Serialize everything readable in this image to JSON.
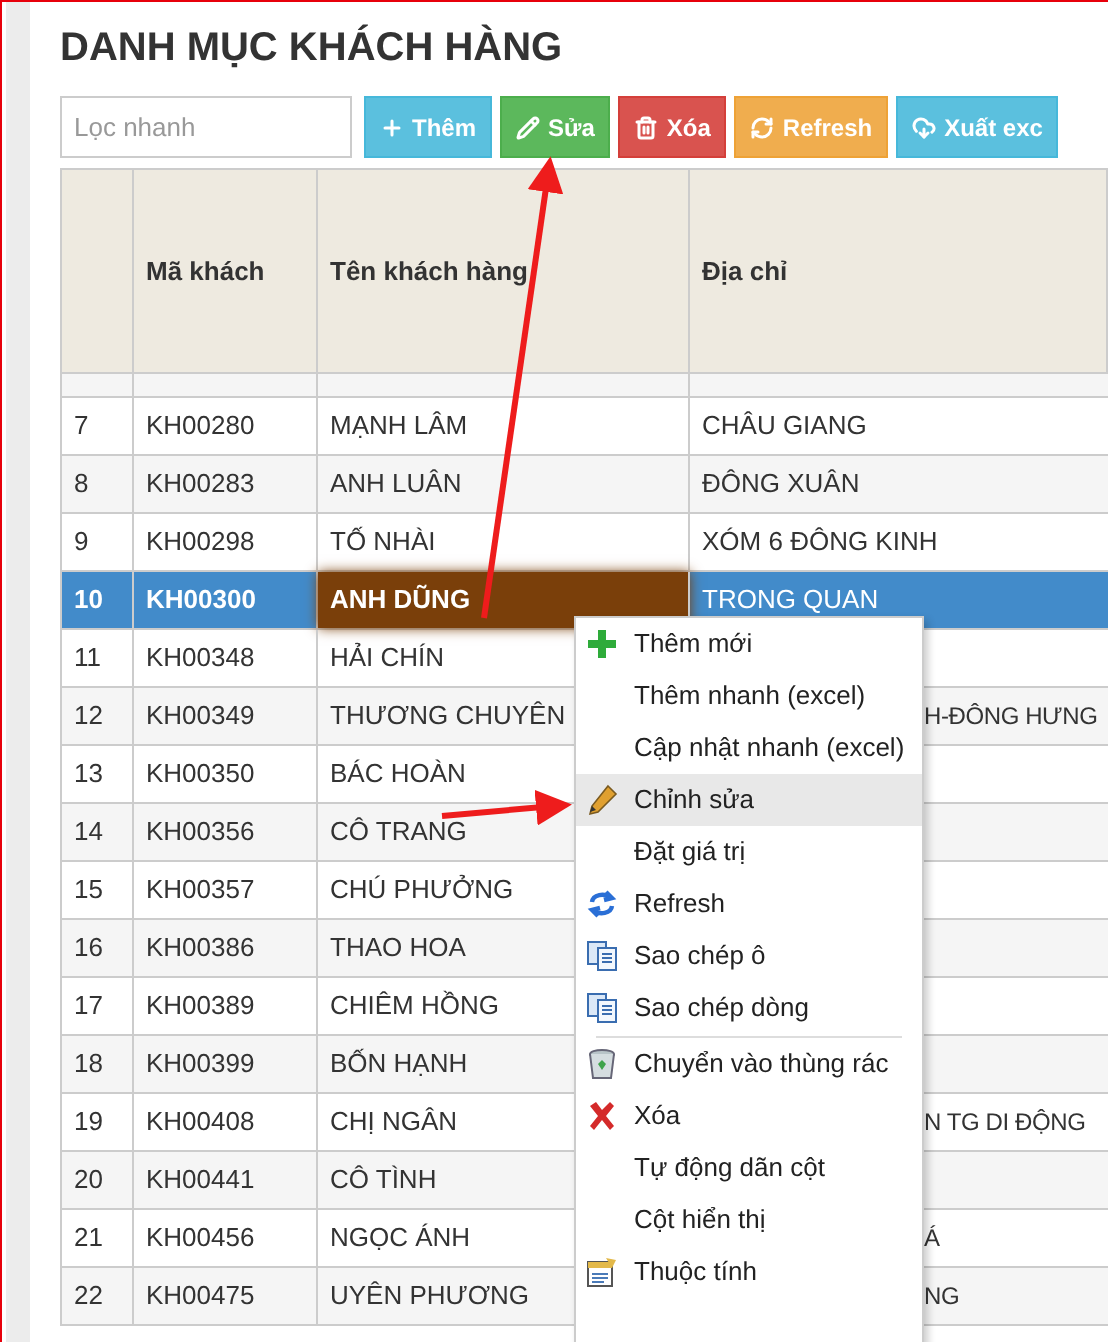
{
  "title": "DANH MỤC KHÁCH HÀNG",
  "filter": {
    "placeholder": "Lọc nhanh"
  },
  "buttons": [
    {
      "label": "Thêm",
      "kind": "add"
    },
    {
      "label": "Sửa",
      "kind": "edit"
    },
    {
      "label": "Xóa",
      "kind": "delete"
    },
    {
      "label": "Refresh",
      "kind": "refresh"
    },
    {
      "label": "Xuất exc",
      "kind": "export"
    }
  ],
  "table": {
    "columns": [
      "Mã khách",
      "Tên khách hàng",
      "Địa chỉ"
    ],
    "rows": [
      {
        "no": "7",
        "code": "KH00280",
        "name": "MẠNH LÂM",
        "address": "CHÂU GIANG",
        "selected": false
      },
      {
        "no": "8",
        "code": "KH00283",
        "name": "ANH LUÂN",
        "address": "ĐÔNG XUÂN",
        "selected": false
      },
      {
        "no": "9",
        "code": "KH00298",
        "name": "TỐ NHÀI",
        "address": "XÓM 6 ĐÔNG KINH",
        "selected": false
      },
      {
        "no": "10",
        "code": "KH00300",
        "name": "ANH DŨNG",
        "address": "TRONG QUAN",
        "selected": true
      },
      {
        "no": "11",
        "code": "KH00348",
        "name": "HẢI CHÍN",
        "selected": false
      },
      {
        "no": "12",
        "code": "KH00349",
        "name": "THƯƠNG CHUYÊN",
        "address": "H-ĐÔNG HƯNG",
        "selected": false,
        "covered": true
      },
      {
        "no": "13",
        "code": "KH00350",
        "name": "BÁC HOÀN",
        "selected": false
      },
      {
        "no": "14",
        "code": "KH00356",
        "name": "CÔ TRANG",
        "selected": false
      },
      {
        "no": "15",
        "code": "KH00357",
        "name": "CHÚ PHƯỞNG",
        "selected": false
      },
      {
        "no": "16",
        "code": "KH00386",
        "name": "THAO HOA",
        "selected": false
      },
      {
        "no": "17",
        "code": "KH00389",
        "name": "CHIÊM HỒNG",
        "selected": false
      },
      {
        "no": "18",
        "code": "KH00399",
        "name": "BỐN HẠNH",
        "selected": false
      },
      {
        "no": "19",
        "code": "KH00408",
        "name": "CHỊ NGÂN",
        "address": "N TG DI ĐỘNG",
        "selected": false,
        "covered": true
      },
      {
        "no": "20",
        "code": "KH00441",
        "name": "CÔ TÌNH",
        "selected": false
      },
      {
        "no": "21",
        "code": "KH00456",
        "name": "NGỌC ÁNH",
        "address": "Á",
        "selected": false,
        "covered": true
      },
      {
        "no": "22",
        "code": "KH00475",
        "name": "UYÊN PHƯƠNG",
        "address": "NG",
        "selected": false,
        "covered": true
      }
    ]
  },
  "context_menu": [
    {
      "kind": "item",
      "label": "Thêm mới",
      "hovered": false
    },
    {
      "kind": "item",
      "label": "Thêm nhanh (excel)",
      "hovered": false
    },
    {
      "kind": "item",
      "label": "Cập nhật nhanh (excel)",
      "hovered": false
    },
    {
      "kind": "item",
      "label": "Chỉnh sửa",
      "hovered": true
    },
    {
      "kind": "item",
      "label": "Đặt giá trị",
      "hovered": false
    },
    {
      "kind": "item",
      "label": "Refresh",
      "hovered": false
    },
    {
      "kind": "item",
      "label": "Sao chép ô",
      "hovered": false
    },
    {
      "kind": "item",
      "label": "Sao chép dòng",
      "hovered": false
    },
    {
      "kind": "separator"
    },
    {
      "kind": "item",
      "label": "Chuyển vào thùng rác",
      "hovered": false
    },
    {
      "kind": "item",
      "label": "Xóa",
      "hovered": false
    },
    {
      "kind": "item",
      "label": "Tự động dãn cột",
      "hovered": false
    },
    {
      "kind": "item",
      "label": "Cột hiển thị",
      "hovered": false
    },
    {
      "kind": "item",
      "label": "Thuộc tính",
      "hovered": false
    }
  ]
}
